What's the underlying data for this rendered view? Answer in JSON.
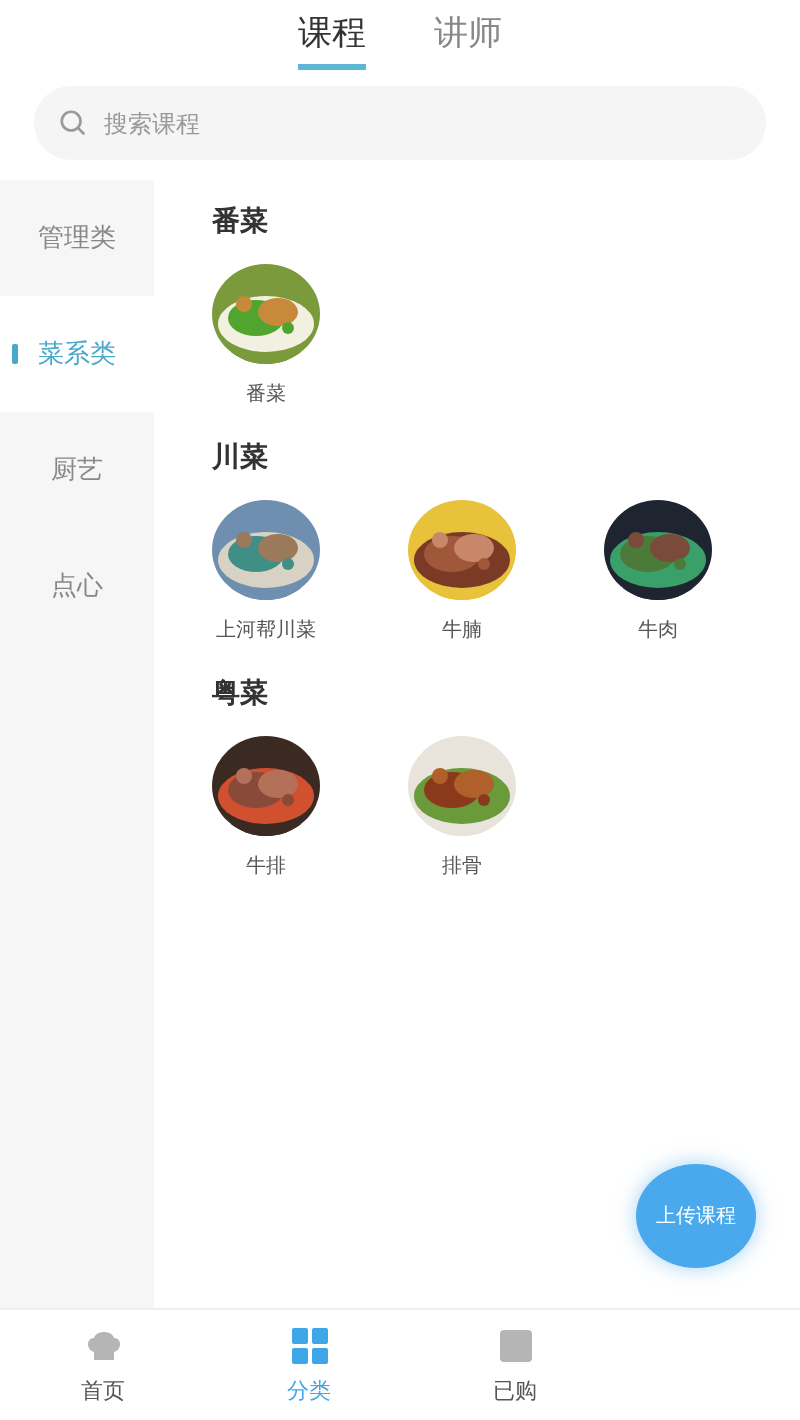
{
  "top_tabs": [
    {
      "label": "课程",
      "selected": true
    },
    {
      "label": "讲师",
      "selected": false
    }
  ],
  "search": {
    "placeholder": "搜索课程"
  },
  "sidebar": {
    "items": [
      {
        "label": "管理类",
        "selected": false
      },
      {
        "label": "菜系类",
        "selected": true
      },
      {
        "label": "厨艺",
        "selected": false
      },
      {
        "label": "点心",
        "selected": false
      }
    ]
  },
  "sections": [
    {
      "title": "番菜",
      "courses": [
        {
          "name": "番菜",
          "kind": "picture"
        }
      ]
    },
    {
      "title": "川菜",
      "courses": [
        {
          "name": "上河帮川菜",
          "kind": "picture"
        },
        {
          "name": "牛腩",
          "kind": "picture"
        },
        {
          "name": "牛肉",
          "kind": "picture"
        }
      ]
    },
    {
      "title": "粤菜",
      "courses": [
        {
          "name": "牛排",
          "kind": "picture"
        },
        {
          "name": "排骨",
          "kind": "picture"
        }
      ]
    }
  ],
  "upload_button": {
    "label": "上传课程"
  },
  "bottom_nav": [
    {
      "label": "首页",
      "selected": false
    },
    {
      "label": "分类",
      "selected": true
    },
    {
      "label": "已购",
      "selected": false
    }
  ]
}
